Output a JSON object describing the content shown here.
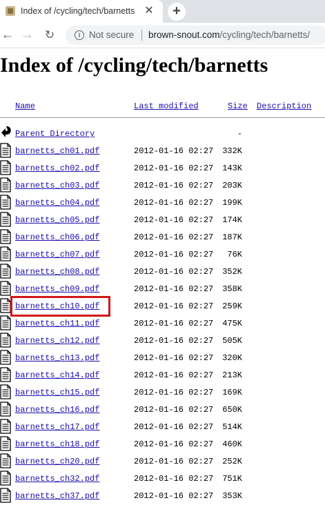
{
  "browser": {
    "tab_title": "Index of /cycling/tech/barnetts",
    "tab_close": "✕",
    "new_tab": "+",
    "security_text": "Not secure",
    "url_host": "brown-snout.com",
    "url_path": "/cycling/tech/barnetts/"
  },
  "page": {
    "heading": "Index of /cycling/tech/barnetts",
    "columns": {
      "name": "Name",
      "last_modified": "Last modified",
      "size": "Size",
      "description": "Description"
    },
    "parent": {
      "name": "Parent Directory",
      "size": "-"
    },
    "files": [
      {
        "name": "barnetts_ch01.pdf",
        "date": "2012-01-16 02:27",
        "size": "332K"
      },
      {
        "name": "barnetts_ch02.pdf",
        "date": "2012-01-16 02:27",
        "size": "143K"
      },
      {
        "name": "barnetts_ch03.pdf",
        "date": "2012-01-16 02:27",
        "size": "203K"
      },
      {
        "name": "barnetts_ch04.pdf",
        "date": "2012-01-16 02:27",
        "size": "199K"
      },
      {
        "name": "barnetts_ch05.pdf",
        "date": "2012-01-16 02:27",
        "size": "174K"
      },
      {
        "name": "barnetts_ch06.pdf",
        "date": "2012-01-16 02:27",
        "size": "187K"
      },
      {
        "name": "barnetts_ch07.pdf",
        "date": "2012-01-16 02:27",
        "size": "76K"
      },
      {
        "name": "barnetts_ch08.pdf",
        "date": "2012-01-16 02:27",
        "size": "352K"
      },
      {
        "name": "barnetts_ch09.pdf",
        "date": "2012-01-16 02:27",
        "size": "358K"
      },
      {
        "name": "barnetts_ch10.pdf",
        "date": "2012-01-16 02:27",
        "size": "259K"
      },
      {
        "name": "barnetts_ch11.pdf",
        "date": "2012-01-16 02:27",
        "size": "475K"
      },
      {
        "name": "barnetts_ch12.pdf",
        "date": "2012-01-16 02:27",
        "size": "505K"
      },
      {
        "name": "barnetts_ch13.pdf",
        "date": "2012-01-16 02:27",
        "size": "320K"
      },
      {
        "name": "barnetts_ch14.pdf",
        "date": "2012-01-16 02:27",
        "size": "213K"
      },
      {
        "name": "barnetts_ch15.pdf",
        "date": "2012-01-16 02:27",
        "size": "169K"
      },
      {
        "name": "barnetts_ch16.pdf",
        "date": "2012-01-16 02:27",
        "size": "650K"
      },
      {
        "name": "barnetts_ch17.pdf",
        "date": "2012-01-16 02:27",
        "size": "514K"
      },
      {
        "name": "barnetts_ch18.pdf",
        "date": "2012-01-16 02:27",
        "size": "460K"
      },
      {
        "name": "barnetts_ch20.pdf",
        "date": "2012-01-16 02:27",
        "size": "252K"
      },
      {
        "name": "barnetts_ch32.pdf",
        "date": "2012-01-16 02:27",
        "size": "751K"
      },
      {
        "name": "barnetts_ch37.pdf",
        "date": "2012-01-16 02:27",
        "size": "353K"
      }
    ],
    "highlighted_file": "barnetts_ch10.pdf"
  },
  "colors": {
    "link": "#1a0dab",
    "highlight_border": "#d01818",
    "tab_strip": "#dee1e6"
  }
}
